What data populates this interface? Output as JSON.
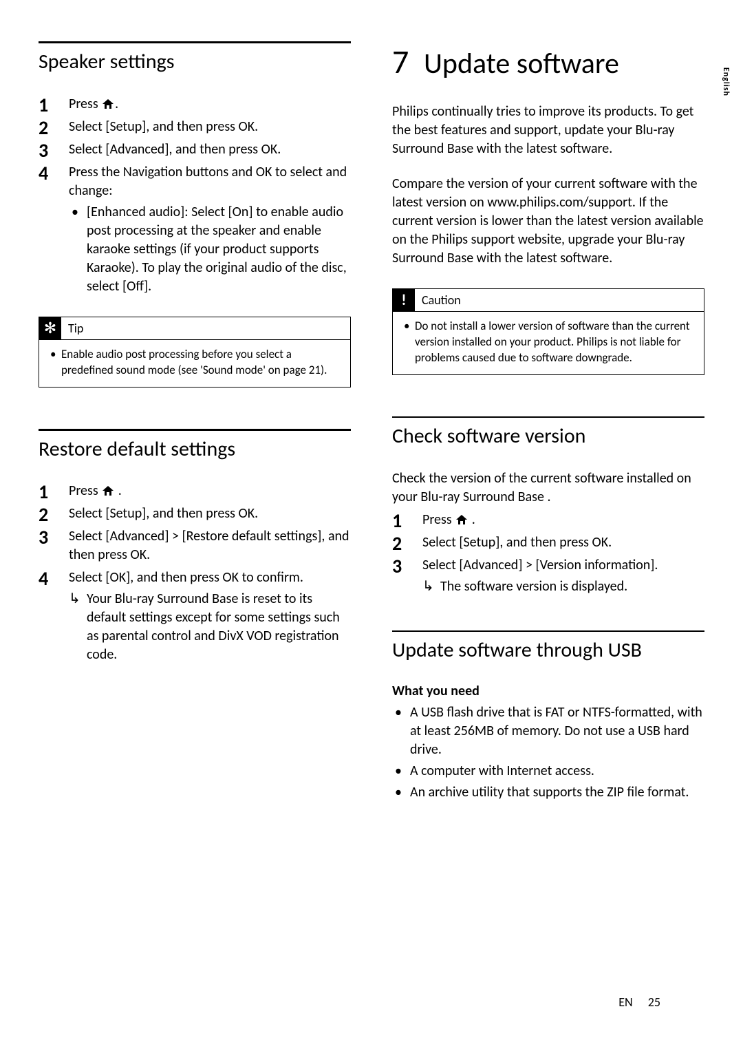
{
  "side_lang": "English",
  "footer": {
    "code": "EN",
    "page": "25"
  },
  "left": {
    "speaker": {
      "title": "Speaker settings",
      "steps": [
        {
          "pre": "Press ",
          "icon": true,
          "post": "."
        },
        {
          "full": "Select [Setup], and then press OK."
        },
        {
          "full": "Select [Advanced], and then press OK."
        },
        {
          "full": "Press the Navigation buttons and OK to select and change:"
        }
      ],
      "sub_bullet": "[Enhanced audio]: Select [On] to enable audio post processing at the speaker and enable karaoke settings (if your product supports Karaoke). To play the original audio of the disc, select [Off].",
      "tip_title": "Tip",
      "tip_body": "Enable audio post processing before you select a predefined sound mode (see 'Sound mode' on page 21)."
    },
    "restore": {
      "title": "Restore default settings",
      "steps": [
        {
          "pre": "Press ",
          "icon": true,
          "post": " ."
        },
        {
          "full": "Select [Setup], and then press OK."
        },
        {
          "full": "Select [Advanced] > [Restore default settings], and then press OK."
        },
        {
          "full": "Select [OK], and then press OK to confirm."
        }
      ],
      "result": "Your Blu-ray Surround Base  is reset to its default settings except for some settings such as parental control and DivX VOD registration code."
    }
  },
  "right": {
    "chapter_num": "7",
    "chapter_title": "Update software",
    "intro1": "Philips continually tries to improve its products. To get the best features and support, update your Blu-ray Surround Base  with the latest software.",
    "intro2": "Compare the version of your current software with the latest version on www.philips.com/support. If the current version is lower than the latest version available on the Philips support website, upgrade your Blu-ray Surround Base with the latest software.",
    "caution_title": "Caution",
    "caution_body": "Do not install a lower version of software than the current version installed on your product. Philips is not liable for problems caused due to software downgrade.",
    "check": {
      "title": "Check software version",
      "intro": "Check the version of the current software installed on your Blu-ray Surround Base .",
      "steps": [
        {
          "pre": "Press ",
          "icon": true,
          "post": " ."
        },
        {
          "full": "Select [Setup], and then press OK."
        },
        {
          "full": "Select [Advanced] > [Version information]."
        }
      ],
      "result": "The software version is displayed."
    },
    "usb": {
      "title": "Update software through USB",
      "subhead": "What you need",
      "bullets": [
        "A USB flash drive that is FAT or NTFS-formatted, with at least 256MB of memory. Do not use a USB hard drive.",
        "A computer with Internet access.",
        "An archive utility that supports the ZIP file format."
      ]
    }
  }
}
